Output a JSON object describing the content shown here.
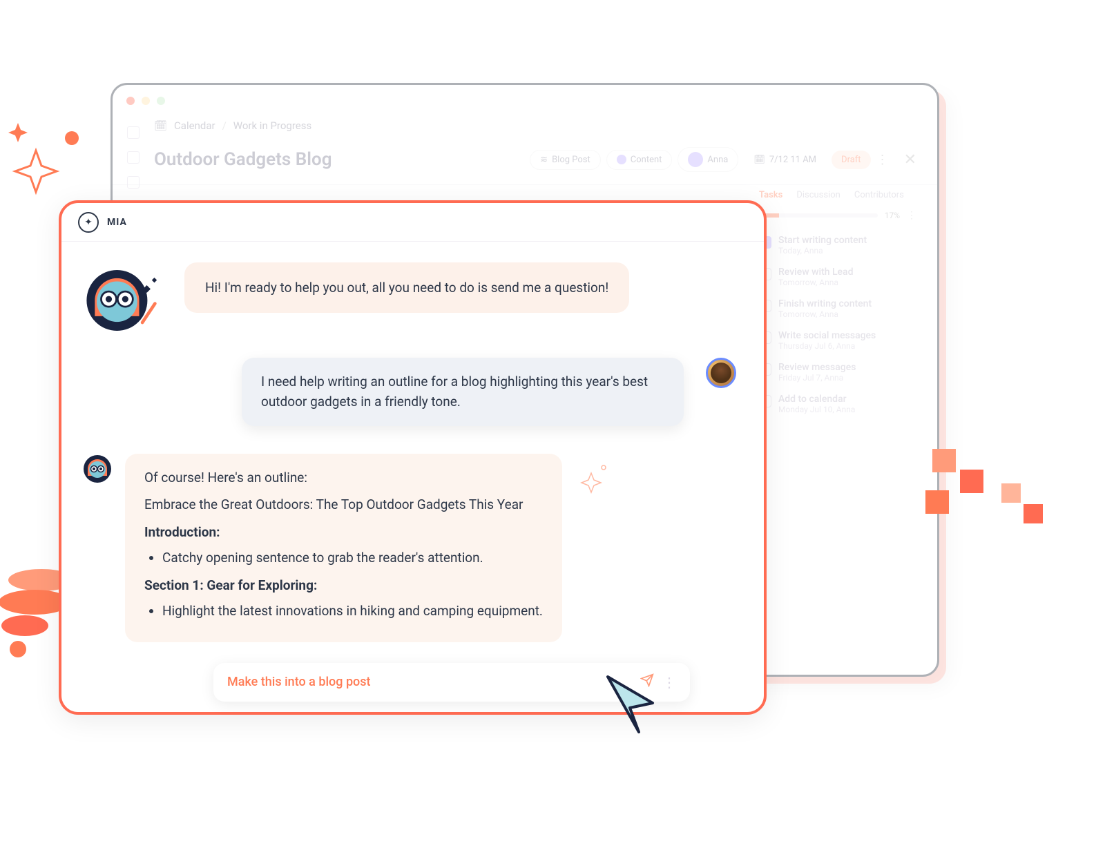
{
  "assistant": {
    "name": "MIA",
    "greeting": "Hi! I'm ready to help you out, all you need to do is send me a question!",
    "outline": {
      "intro": "Of course! Here's an outline:",
      "title": "Embrace the Great Outdoors: The Top Outdoor Gadgets This Year",
      "section_intro_heading": "Introduction:",
      "section_intro_bullet": "Catchy opening sentence to grab the reader's attention.",
      "section1_heading": "Section 1: Gear for Exploring:",
      "section1_bullet": "Highlight the latest innovations in hiking and camping equipment."
    }
  },
  "user": {
    "message": "I need help writing an outline for a blog highlighting this year's best outdoor gadgets in a friendly tone."
  },
  "composer": {
    "text": "Make this into a blog post"
  },
  "background": {
    "breadcrumb": {
      "calendar": "Calendar",
      "page": "Work in Progress"
    },
    "title": "Outdoor Gadgets Blog",
    "chips": {
      "blog_post": "Blog Post",
      "content": "Content",
      "user": "Anna",
      "date": "7/12 11 AM",
      "status": "Draft"
    },
    "tabs": {
      "tasks": "Tasks",
      "discussion": "Discussion",
      "contributors": "Contributors"
    },
    "progress": "17%",
    "tasks": [
      {
        "title": "Start writing content",
        "sub": "Today, Anna",
        "done": true
      },
      {
        "title": "Review with Lead",
        "sub": "Tomorrow, Anna",
        "done": false
      },
      {
        "title": "Finish writing content",
        "sub": "Tomorrow, Anna",
        "done": false
      },
      {
        "title": "Write social messages",
        "sub": "Thursday Jul 6, Anna",
        "done": false
      },
      {
        "title": "Review messages",
        "sub": "Friday Jul 7, Anna",
        "done": false
      },
      {
        "title": "Add to calendar",
        "sub": "Monday Jul 10, Anna",
        "done": false
      }
    ]
  }
}
